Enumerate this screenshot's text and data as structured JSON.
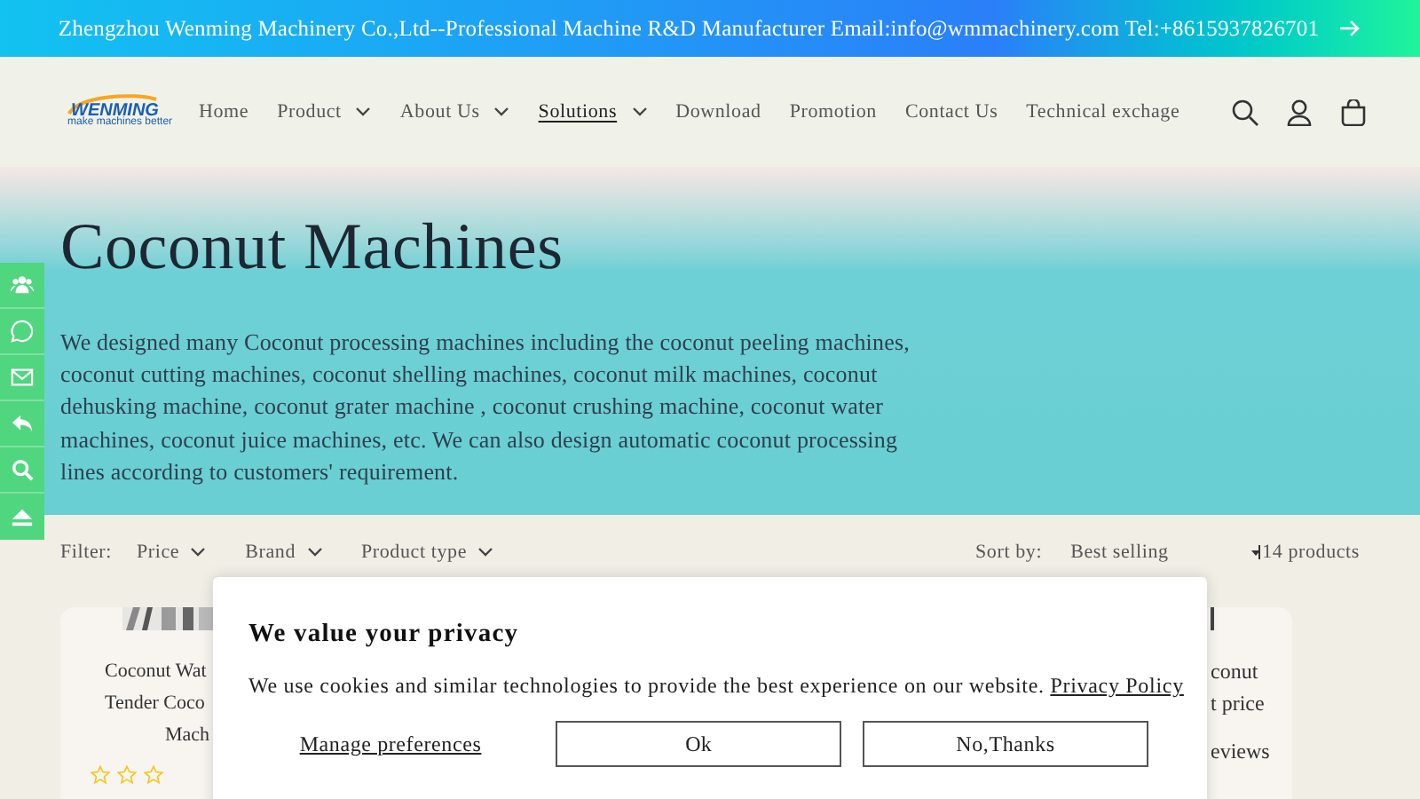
{
  "announcement": {
    "text": "Zhengzhou Wenming Machinery Co.,Ltd--Professional Machine R&D Manufacturer Email:info@wmmachinery.com Tel:+8615937826701"
  },
  "header": {
    "logo": {
      "name": "WENMING",
      "tagline": "make machines better"
    },
    "nav": [
      {
        "label": "Home",
        "dropdown": false,
        "selected": false
      },
      {
        "label": "Product",
        "dropdown": true,
        "selected": false
      },
      {
        "label": "About Us",
        "dropdown": true,
        "selected": false
      },
      {
        "label": "Solutions",
        "dropdown": true,
        "selected": true
      },
      {
        "label": "Download",
        "dropdown": false,
        "selected": false
      },
      {
        "label": "Promotion",
        "dropdown": false,
        "selected": false
      },
      {
        "label": "Contact Us",
        "dropdown": false,
        "selected": false
      },
      {
        "label": "Technical exchage",
        "dropdown": false,
        "selected": false
      }
    ]
  },
  "hero": {
    "title": "Coconut Machines",
    "description": "We designed many Coconut processing machines including the coconut peeling machines, coconut cutting machines, coconut shelling machines, coconut milk machines, coconut dehusking machine, coconut grater machine , coconut crushing machine, coconut water machines, coconut juice machines, etc.  We can also design automatic coconut processing lines according to customers' requirement."
  },
  "filters": {
    "label": "Filter:",
    "items": [
      "Price",
      "Brand",
      "Product type"
    ],
    "sort_label": "Sort by:",
    "sort_value": "Best selling",
    "count": "14 products"
  },
  "products": [
    {
      "lines": [
        "Coconut Wat",
        "Tender Coco",
        "Mach"
      ],
      "stars": 0
    },
    {
      "lines": [
        "conut",
        "t price",
        "eviews"
      ]
    }
  ],
  "privacy_popup": {
    "title": "We value your privacy",
    "text": "We use cookies and similar technologies to provide the best experience on our website.",
    "link": "Privacy Policy",
    "buttons": [
      "Manage preferences",
      "Ok",
      "No,Thanks"
    ]
  }
}
